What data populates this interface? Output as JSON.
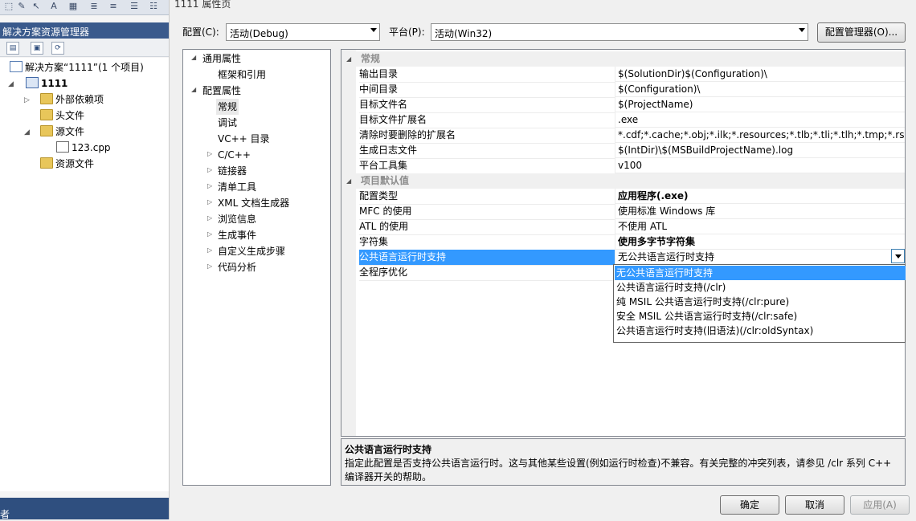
{
  "ide": {
    "toolbar_icons": [
      "select-icon",
      "tool-icon",
      "cursor-icon",
      "rename-icon",
      "grid-icon",
      "outdent-icon",
      "indent-icon",
      "comment-icon",
      "uncomment-icon"
    ],
    "solution_explorer": {
      "title": "解决方案资源管理器",
      "toolbar_icons": [
        "properties-icon",
        "show-all-files-icon",
        "refresh-icon"
      ],
      "tree": {
        "solution": "解决方案“1111”(1 个项目)",
        "project": "1111",
        "external": "外部依赖项",
        "headers": "头文件",
        "sources": "源文件",
        "file": "123.cpp",
        "resources": "资源文件"
      }
    },
    "bottom_text": "者"
  },
  "dialog": {
    "title": "1111 属性页",
    "config_label": "配置(C):",
    "config_value": "活动(Debug)",
    "platform_label": "平台(P):",
    "platform_value": "活动(Win32)",
    "config_manager": "配置管理器(O)...",
    "nav": {
      "common": "通用属性",
      "framework": "框架和引用",
      "config": "配置属性",
      "general": "常规",
      "debug": "调试",
      "vc_dirs": "VC++ 目录",
      "cpp": "C/C++",
      "linker": "链接器",
      "manifest": "清单工具",
      "xml": "XML 文档生成器",
      "browse": "浏览信息",
      "build_events": "生成事件",
      "custom_build": "自定义生成步骤",
      "code_analysis": "代码分析"
    },
    "grid": {
      "cat_general": "常规",
      "rows_general": [
        {
          "name": "输出目录",
          "value": "$(SolutionDir)$(Configuration)\\"
        },
        {
          "name": "中间目录",
          "value": "$(Configuration)\\"
        },
        {
          "name": "目标文件名",
          "value": "$(ProjectName)"
        },
        {
          "name": "目标文件扩展名",
          "value": ".exe"
        },
        {
          "name": "清除时要删除的扩展名",
          "value": "*.cdf;*.cache;*.obj;*.ilk;*.resources;*.tlb;*.tli;*.tlh;*.tmp;*.rsp;*.pgc"
        },
        {
          "name": "生成日志文件",
          "value": "$(IntDir)\\$(MSBuildProjectName).log"
        },
        {
          "name": "平台工具集",
          "value": "v100"
        }
      ],
      "cat_defaults": "项目默认值",
      "rows_defaults": [
        {
          "name": "配置类型",
          "value": "应用程序(.exe)"
        },
        {
          "name": "MFC 的使用",
          "value": "使用标准 Windows 库"
        },
        {
          "name": "ATL 的使用",
          "value": "不使用 ATL"
        },
        {
          "name": "字符集",
          "value": "使用多字节字符集"
        },
        {
          "name": "公共语言运行时支持",
          "value": "无公共语言运行时支持"
        },
        {
          "name": "全程序优化",
          "value": ""
        }
      ],
      "dropdown_options": [
        "无公共语言运行时支持",
        "公共语言运行时支持(/clr)",
        "纯 MSIL 公共语言运行时支持(/clr:pure)",
        "安全 MSIL 公共语言运行时支持(/clr:safe)",
        "公共语言运行时支持(旧语法)(/clr:oldSyntax)"
      ]
    },
    "description": {
      "title": "公共语言运行时支持",
      "text": "指定此配置是否支持公共语言运行时。这与其他某些设置(例如运行时检查)不兼容。有关完整的冲突列表，请参见 /clr 系列 C++ 编译器开关的帮助。"
    },
    "buttons": {
      "ok": "确定",
      "cancel": "取消",
      "apply": "应用(A)"
    }
  }
}
